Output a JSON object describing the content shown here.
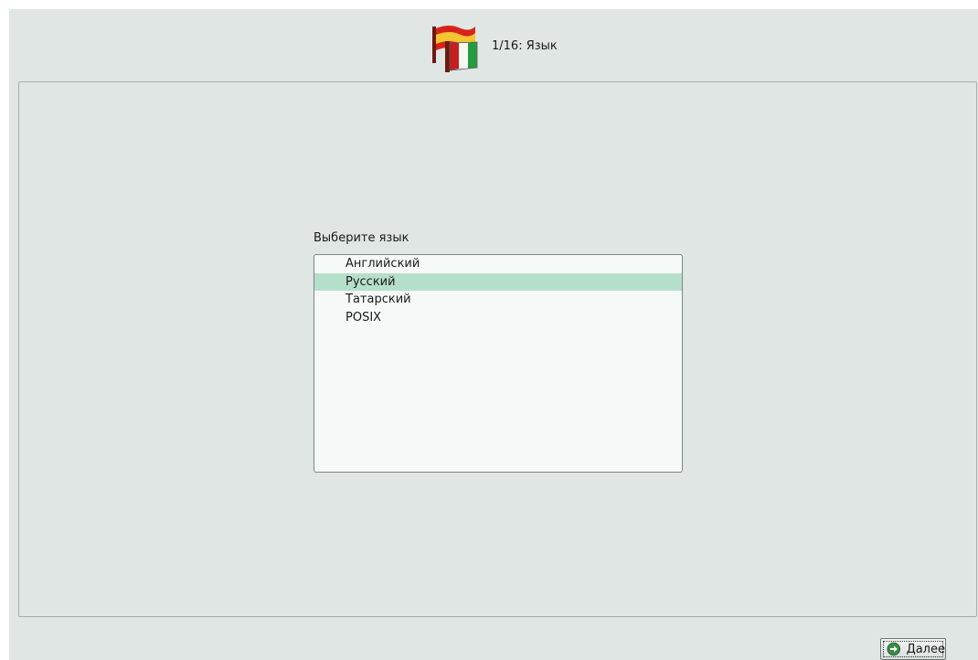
{
  "header": {
    "title": "1/16: Язык",
    "icon": "flags-icon"
  },
  "language_section": {
    "label": "Выберите язык",
    "items": [
      {
        "label": "Английский",
        "selected": false
      },
      {
        "label": "Русский",
        "selected": true
      },
      {
        "label": "Татарский",
        "selected": false
      },
      {
        "label": "POSIX",
        "selected": false
      }
    ]
  },
  "footer": {
    "next_label": "Далее",
    "next_icon": "arrow-right-circle-icon"
  },
  "colors": {
    "background": "#dfe6e4",
    "list_background": "#f5f9f7",
    "selection": "#b6dfc9",
    "next_icon_green": "#2f6b3a"
  }
}
